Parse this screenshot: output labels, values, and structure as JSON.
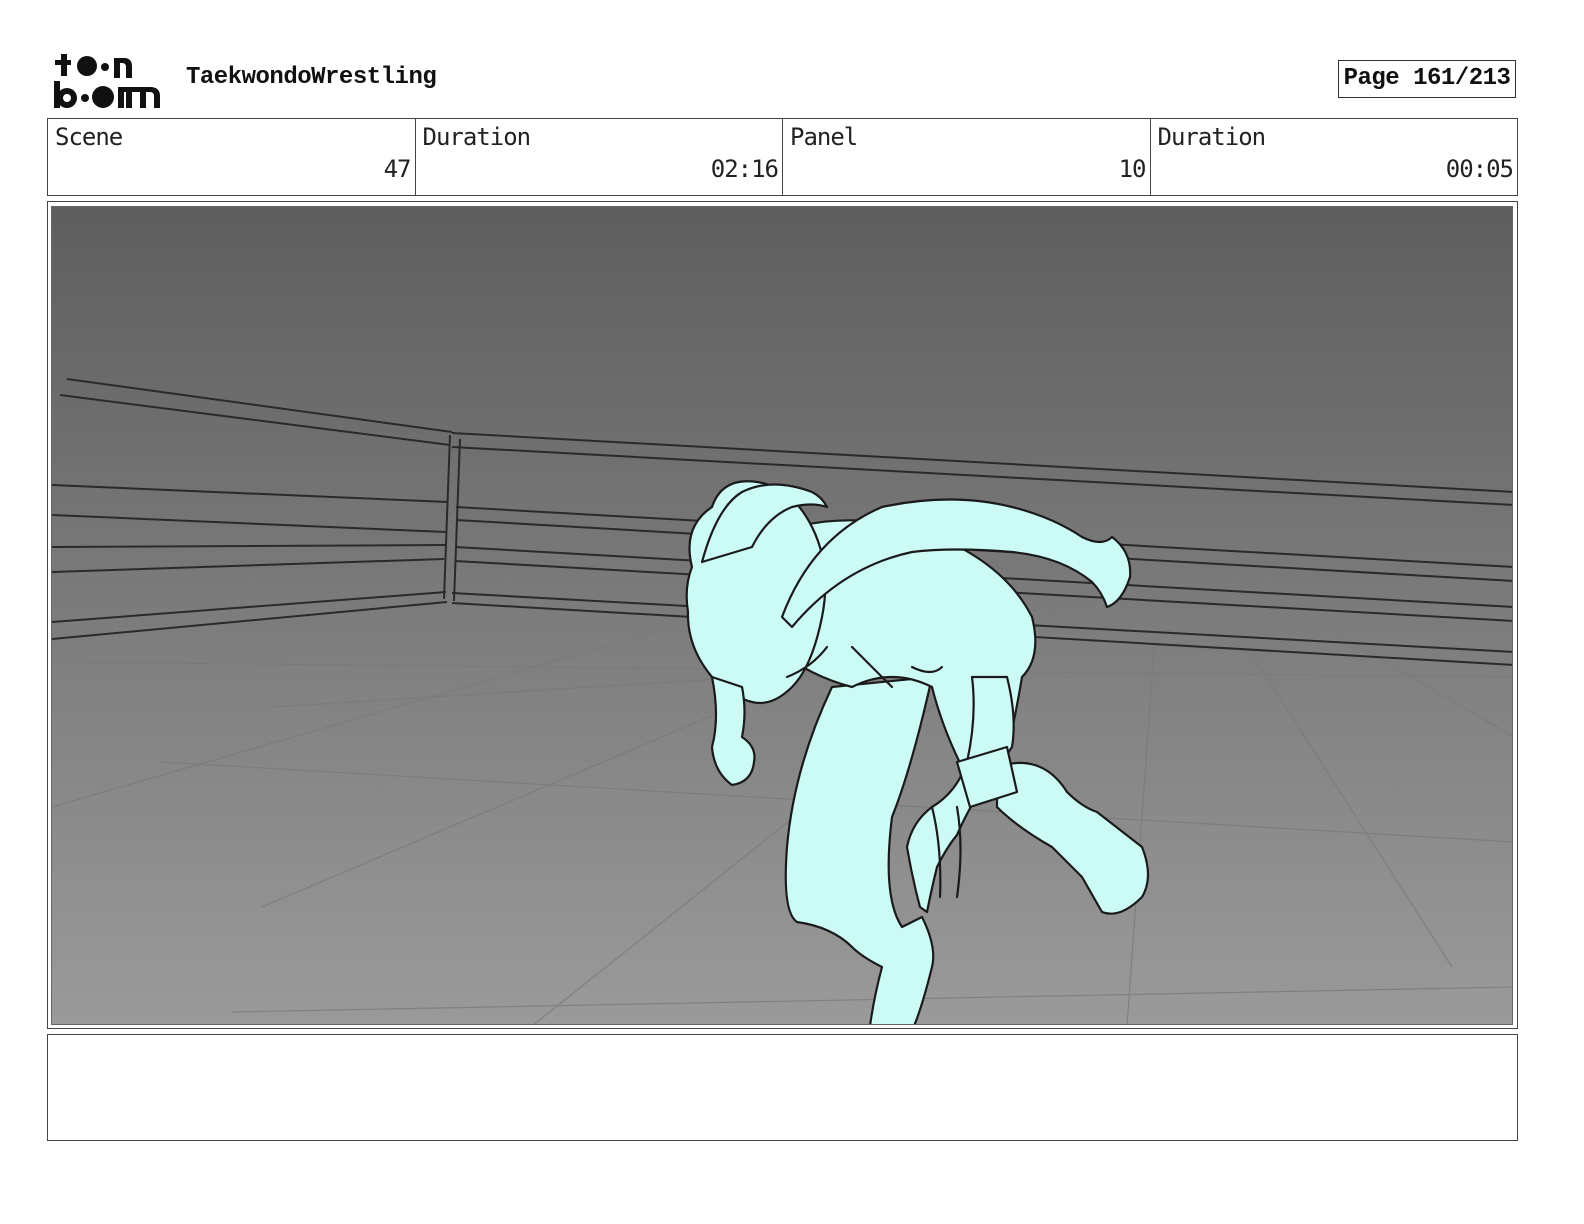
{
  "header": {
    "logo_text": "toon boom",
    "project_title": "TaekwondoWrestling",
    "page_label": "Page 161/213"
  },
  "info": {
    "scene_label": "Scene",
    "scene_value": "47",
    "scene_duration_label": "Duration",
    "scene_duration_value": "02:16",
    "panel_label": "Panel",
    "panel_value": "10",
    "panel_duration_label": "Duration",
    "panel_duration_value": "00:05"
  },
  "panel": {
    "background_top_color": "#5e5e5e",
    "background_bottom_color": "#9a9a9a",
    "figure_color": "#ccfbf6",
    "line_color": "#1a1a1a"
  },
  "notes": {
    "text": ""
  }
}
